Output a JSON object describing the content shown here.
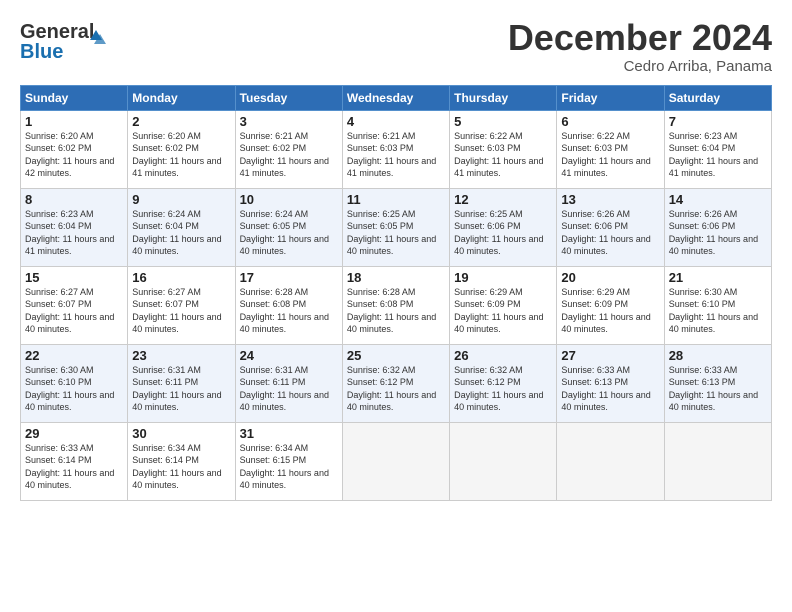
{
  "logo": {
    "line1": "General",
    "line2": "Blue"
  },
  "header": {
    "title": "December 2024",
    "location": "Cedro Arriba, Panama"
  },
  "weekdays": [
    "Sunday",
    "Monday",
    "Tuesday",
    "Wednesday",
    "Thursday",
    "Friday",
    "Saturday"
  ],
  "weeks": [
    [
      {
        "day": "1",
        "sunrise": "6:20 AM",
        "sunset": "6:02 PM",
        "daylight": "11 hours and 42 minutes."
      },
      {
        "day": "2",
        "sunrise": "6:20 AM",
        "sunset": "6:02 PM",
        "daylight": "11 hours and 41 minutes."
      },
      {
        "day": "3",
        "sunrise": "6:21 AM",
        "sunset": "6:02 PM",
        "daylight": "11 hours and 41 minutes."
      },
      {
        "day": "4",
        "sunrise": "6:21 AM",
        "sunset": "6:03 PM",
        "daylight": "11 hours and 41 minutes."
      },
      {
        "day": "5",
        "sunrise": "6:22 AM",
        "sunset": "6:03 PM",
        "daylight": "11 hours and 41 minutes."
      },
      {
        "day": "6",
        "sunrise": "6:22 AM",
        "sunset": "6:03 PM",
        "daylight": "11 hours and 41 minutes."
      },
      {
        "day": "7",
        "sunrise": "6:23 AM",
        "sunset": "6:04 PM",
        "daylight": "11 hours and 41 minutes."
      }
    ],
    [
      {
        "day": "8",
        "sunrise": "6:23 AM",
        "sunset": "6:04 PM",
        "daylight": "11 hours and 41 minutes."
      },
      {
        "day": "9",
        "sunrise": "6:24 AM",
        "sunset": "6:04 PM",
        "daylight": "11 hours and 40 minutes."
      },
      {
        "day": "10",
        "sunrise": "6:24 AM",
        "sunset": "6:05 PM",
        "daylight": "11 hours and 40 minutes."
      },
      {
        "day": "11",
        "sunrise": "6:25 AM",
        "sunset": "6:05 PM",
        "daylight": "11 hours and 40 minutes."
      },
      {
        "day": "12",
        "sunrise": "6:25 AM",
        "sunset": "6:06 PM",
        "daylight": "11 hours and 40 minutes."
      },
      {
        "day": "13",
        "sunrise": "6:26 AM",
        "sunset": "6:06 PM",
        "daylight": "11 hours and 40 minutes."
      },
      {
        "day": "14",
        "sunrise": "6:26 AM",
        "sunset": "6:06 PM",
        "daylight": "11 hours and 40 minutes."
      }
    ],
    [
      {
        "day": "15",
        "sunrise": "6:27 AM",
        "sunset": "6:07 PM",
        "daylight": "11 hours and 40 minutes."
      },
      {
        "day": "16",
        "sunrise": "6:27 AM",
        "sunset": "6:07 PM",
        "daylight": "11 hours and 40 minutes."
      },
      {
        "day": "17",
        "sunrise": "6:28 AM",
        "sunset": "6:08 PM",
        "daylight": "11 hours and 40 minutes."
      },
      {
        "day": "18",
        "sunrise": "6:28 AM",
        "sunset": "6:08 PM",
        "daylight": "11 hours and 40 minutes."
      },
      {
        "day": "19",
        "sunrise": "6:29 AM",
        "sunset": "6:09 PM",
        "daylight": "11 hours and 40 minutes."
      },
      {
        "day": "20",
        "sunrise": "6:29 AM",
        "sunset": "6:09 PM",
        "daylight": "11 hours and 40 minutes."
      },
      {
        "day": "21",
        "sunrise": "6:30 AM",
        "sunset": "6:10 PM",
        "daylight": "11 hours and 40 minutes."
      }
    ],
    [
      {
        "day": "22",
        "sunrise": "6:30 AM",
        "sunset": "6:10 PM",
        "daylight": "11 hours and 40 minutes."
      },
      {
        "day": "23",
        "sunrise": "6:31 AM",
        "sunset": "6:11 PM",
        "daylight": "11 hours and 40 minutes."
      },
      {
        "day": "24",
        "sunrise": "6:31 AM",
        "sunset": "6:11 PM",
        "daylight": "11 hours and 40 minutes."
      },
      {
        "day": "25",
        "sunrise": "6:32 AM",
        "sunset": "6:12 PM",
        "daylight": "11 hours and 40 minutes."
      },
      {
        "day": "26",
        "sunrise": "6:32 AM",
        "sunset": "6:12 PM",
        "daylight": "11 hours and 40 minutes."
      },
      {
        "day": "27",
        "sunrise": "6:33 AM",
        "sunset": "6:13 PM",
        "daylight": "11 hours and 40 minutes."
      },
      {
        "day": "28",
        "sunrise": "6:33 AM",
        "sunset": "6:13 PM",
        "daylight": "11 hours and 40 minutes."
      }
    ],
    [
      {
        "day": "29",
        "sunrise": "6:33 AM",
        "sunset": "6:14 PM",
        "daylight": "11 hours and 40 minutes."
      },
      {
        "day": "30",
        "sunrise": "6:34 AM",
        "sunset": "6:14 PM",
        "daylight": "11 hours and 40 minutes."
      },
      {
        "day": "31",
        "sunrise": "6:34 AM",
        "sunset": "6:15 PM",
        "daylight": "11 hours and 40 minutes."
      },
      null,
      null,
      null,
      null
    ]
  ]
}
